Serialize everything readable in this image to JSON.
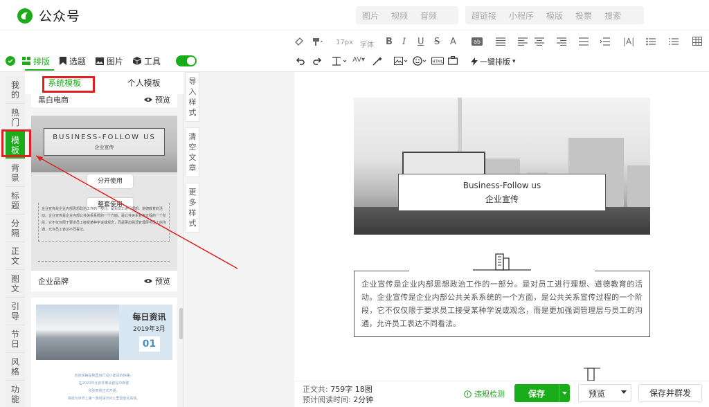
{
  "app": {
    "name": "公众号"
  },
  "header": {
    "nav_group_1": [
      "图片",
      "视频",
      "音频"
    ],
    "nav_group_2": [
      "超链接",
      "小程序",
      "模版",
      "投票",
      "搜索"
    ]
  },
  "toolbar": {
    "font_size": "17px",
    "font_family": "字体",
    "one_click_layout": "一键排版"
  },
  "left_tabs": [
    {
      "label": "排版",
      "icon": "layout-icon",
      "active": true
    },
    {
      "label": "选题",
      "icon": "bookmark-icon",
      "active": false
    },
    {
      "label": "图片",
      "icon": "image-icon",
      "active": false
    },
    {
      "label": "工具",
      "icon": "cube-icon",
      "active": false
    }
  ],
  "categories": [
    "我的",
    "热门",
    "模板",
    "背景",
    "标题",
    "分隔",
    "正文",
    "图文",
    "引导",
    "节日",
    "风格",
    "功能"
  ],
  "active_category": "模板",
  "template_panel": {
    "tab_system": "系统模板",
    "tab_personal": "个人模板",
    "card1": {
      "name": "黑白电商",
      "preview": "预览"
    },
    "card2": {
      "name": "企业品牌",
      "preview": "预览",
      "title_en": "BUSINESS-FOLLOW US",
      "title_cn": "企业宣传",
      "btn_separate": "分开使用",
      "btn_whole": "整套使用",
      "body": "企业宣传是企业内部思想政治工作的一部分。是对员工进行理想、道德教育的活动。企业宣传是企业内部公共关系系统的一个方面，是公共关系宣传过程的一个阶段，它不仅仅限于要求员工接受某种学说或观念，而是更加强调管理层与员工的沟通，允许员工表达不同看法。"
    },
    "card3": {
      "badge_title": "每日资讯",
      "badge_date": "2019年3月",
      "badge_day": "01",
      "lines": [
        "京张铁路是我国自行设计建设的铁路，",
        "在2022年北京冬奥会建设中新建",
        "京张高铁正式开通，",
        "将成为世界上第一条时速350公里智能化高铁。"
      ]
    }
  },
  "side_actions": [
    "导入样式",
    "清空文章",
    "更多样式"
  ],
  "editor": {
    "hero_title": "Business-Follow us",
    "hero_subtitle": "企业宣传",
    "paragraph": "企业宣传是企业内部思想政治工作的一部分。是对员工进行理想、道德教育的活动。企业宣传是企业内部公共关系系统的一个方面，是公共关系宣传过程的一个阶段，它不仅仅限于要求员工接受某种学说或观念，而是更加强调管理层与员工的沟通，允许员工表达不同看法。"
  },
  "bottom": {
    "word_label": "正文共:",
    "word_value": "759字 18图",
    "read_label": "预计阅读时间:",
    "read_value": "2分钟",
    "check_label": "违规检测",
    "save_label": "保存",
    "preview_label": "预览",
    "mass_label": "保存并群发"
  },
  "colors": {
    "accent": "#1aad19",
    "highlight": "#e02020"
  }
}
